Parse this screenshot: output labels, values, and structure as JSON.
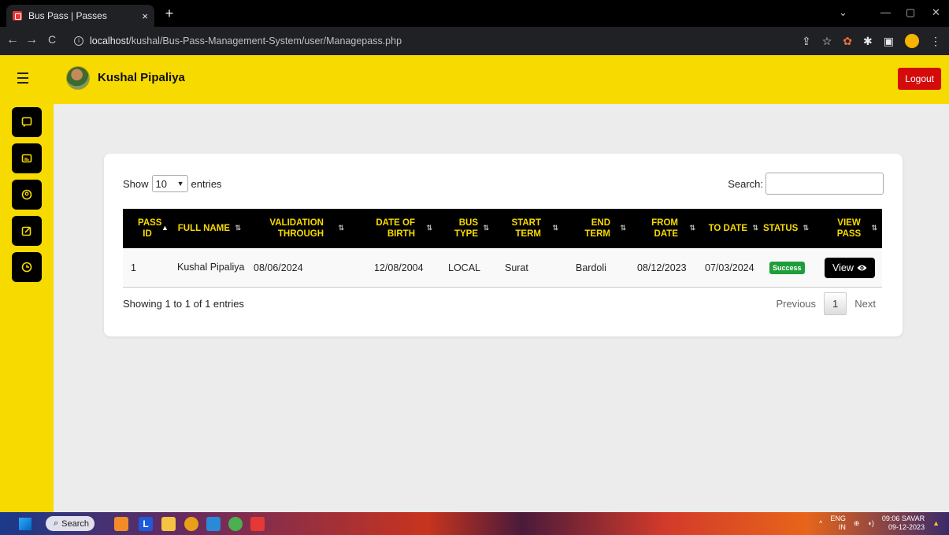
{
  "browser": {
    "tab_title": "Bus Pass | Passes",
    "tab_close": "×",
    "new_tab": "+",
    "url_host": "localhost",
    "url_path": "/kushal/Bus-Pass-Management-System/user/Managepass.php"
  },
  "header": {
    "user_name": "Kushal Pipaliya",
    "logout_label": "Logout"
  },
  "table_controls": {
    "show_label": "Show",
    "entries_count": "10",
    "entries_label": "entries",
    "search_label": "Search:"
  },
  "table": {
    "columns": [
      "PASS ID",
      "FULL NAME",
      "VALIDATION THROUGH",
      "DATE OF BIRTH",
      "BUS TYPE",
      "START TERM",
      "END TERM",
      "FROM DATE",
      "TO DATE",
      "STATUS",
      "VIEW PASS"
    ],
    "rows": [
      {
        "pass_id": "1",
        "full_name": "Kushal Pipaliya",
        "validation_through": "08/06/2024",
        "dob": "12/08/2004",
        "bus_type": "LOCAL",
        "start_term": "Surat",
        "end_term": "Bardoli",
        "from_date": "08/12/2023",
        "to_date": "07/03/2024",
        "status": "Success",
        "view_label": "View"
      }
    ]
  },
  "footer": {
    "info": "Showing 1 to 1 of 1 entries",
    "previous": "Previous",
    "page": "1",
    "next": "Next"
  },
  "taskbar": {
    "search_label": "Search",
    "lang_top": "ENG",
    "lang_bottom": "IN",
    "time": "09:06 SAVAR",
    "date": "09-12-2023"
  },
  "colors": {
    "brand_yellow": "#f7da00",
    "logout_red": "#d40b0b",
    "success_green": "#1e9e3a"
  }
}
